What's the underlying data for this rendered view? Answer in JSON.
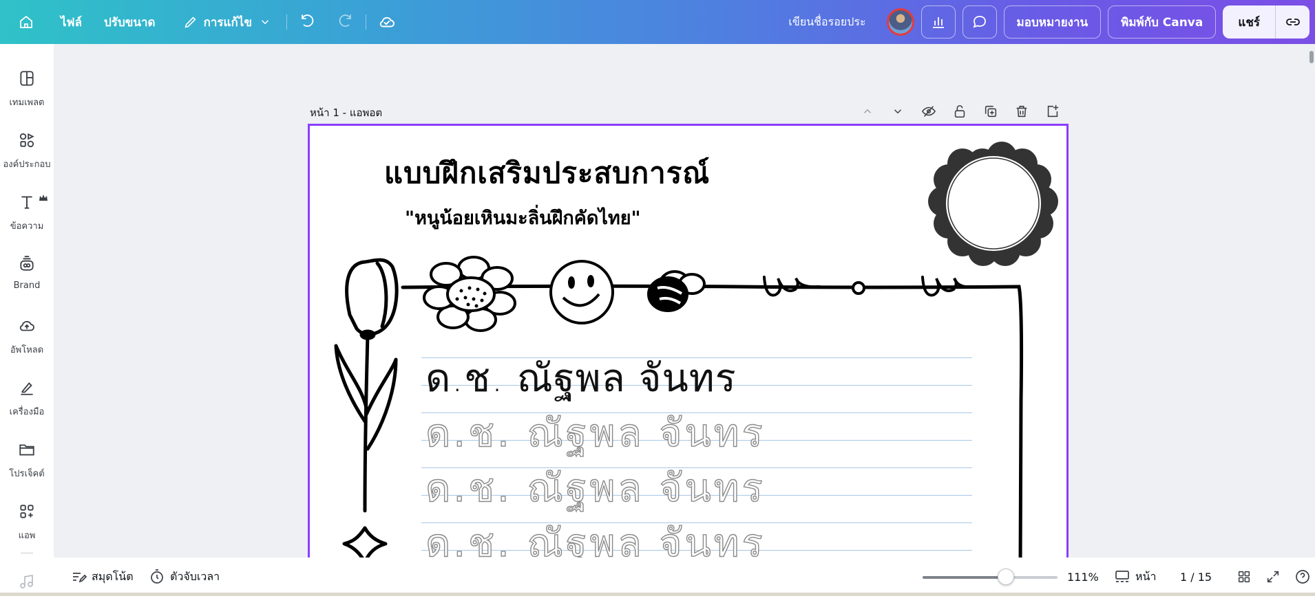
{
  "topbar": {
    "file_label": "ไฟล์",
    "resize_label": "ปรับขนาด",
    "edit_label": "การแก้ไข",
    "design_title": "เขียนชื่อรอยประ",
    "assign_label": "มอบหมายงาน",
    "print_label": "พิมพ์กับ Canva",
    "share_label": "แชร์"
  },
  "sidebar": {
    "items": [
      {
        "label": "เทมเพลต",
        "icon": "template-icon"
      },
      {
        "label": "องค์ประกอบ",
        "icon": "elements-icon"
      },
      {
        "label": "ข้อความ",
        "icon": "text-icon"
      },
      {
        "label": "Brand",
        "icon": "brand-icon"
      },
      {
        "label": "อัพโหลด",
        "icon": "upload-icon"
      },
      {
        "label": "เครื่องมือ",
        "icon": "tools-icon"
      },
      {
        "label": "โปรเจ็คต์",
        "icon": "projects-icon"
      },
      {
        "label": "แอพ",
        "icon": "apps-icon"
      }
    ]
  },
  "page": {
    "label": "หน้า 1 - แอพอต"
  },
  "worksheet": {
    "title": "แบบฝึกเสริมประสบการณ์",
    "subtitle": "\"หนูน้อยเหินมะลิ่นฝึกคัดไทย\"",
    "name_solid": "ด.ช. ณัฐพล จันทร",
    "name_dotted": "ด.ช. ณัฐพล จันทร"
  },
  "bottombar": {
    "notes_label": "สมุดโน้ต",
    "timer_label": "ตัวจับเวลา",
    "zoom_value": 111,
    "zoom_label": "111%",
    "pages_label": "หน้า",
    "page_count": "1 / 15"
  },
  "colors": {
    "accent": "#8b3dff",
    "gradient_start": "#2fc2c8",
    "gradient_end": "#7b4fe6",
    "guide_line": "#a7c7e6"
  }
}
